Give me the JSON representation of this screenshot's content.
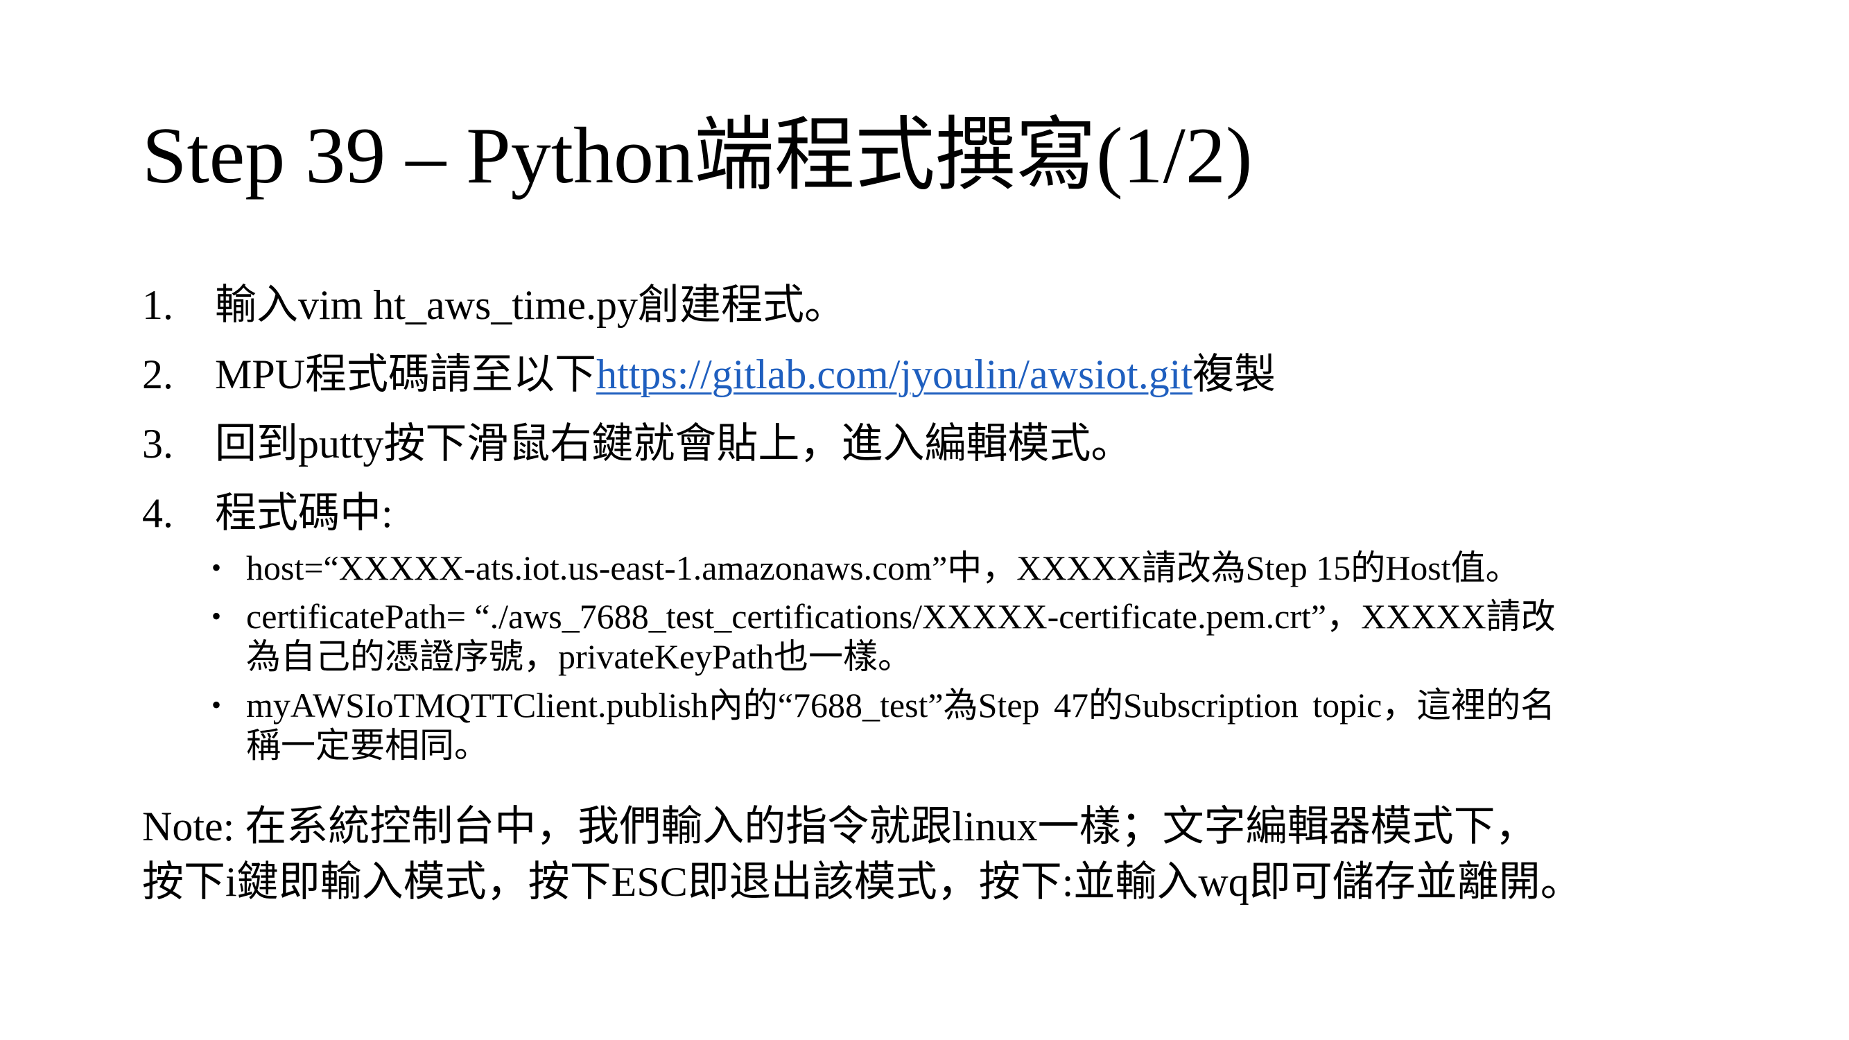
{
  "title": "Step 39 – Python端程式撰寫(1/2)",
  "steps": [
    {
      "num": "1.",
      "text": "輸入vim ht_aws_time.py創建程式。"
    },
    {
      "num": "2.",
      "pre": "MPU程式碼請至以下",
      "link": "https://gitlab.com/jyoulin/awsiot.git",
      "post": "複製"
    },
    {
      "num": "3.",
      "text": "回到putty按下滑鼠右鍵就會貼上，進入編輯模式。"
    },
    {
      "num": "4.",
      "text": "程式碼中:"
    }
  ],
  "bullets": [
    {
      "symbol": "•",
      "text": "host=“XXXXX-ats.iot.us-east-1.amazonaws.com”中，XXXXX請改為Step 15的Host值。"
    },
    {
      "symbol": "•",
      "line1": "certificatePath= “./aws_7688_test_certifications/XXXXX-certificate.pem.crt”，XXXXX請改",
      "line2": "為自己的憑證序號，privateKeyPath也一樣。"
    },
    {
      "symbol": "•",
      "line1": "myAWSIoTMQTTClient.publish內的“7688_test”為Step 47的Subscription topic，這裡的名",
      "line2": "稱一定要相同。"
    }
  ],
  "note": {
    "line1": "Note: 在系統控制台中，我們輸入的指令就跟linux一樣；文字編輯器模式下，",
    "line2": "按下i鍵即輸入模式，按下ESC即退出該模式，按下:並輸入wq即可儲存並離開。"
  },
  "colors": {
    "link": "#1f5fbf",
    "text": "#000000",
    "background": "#ffffff"
  }
}
